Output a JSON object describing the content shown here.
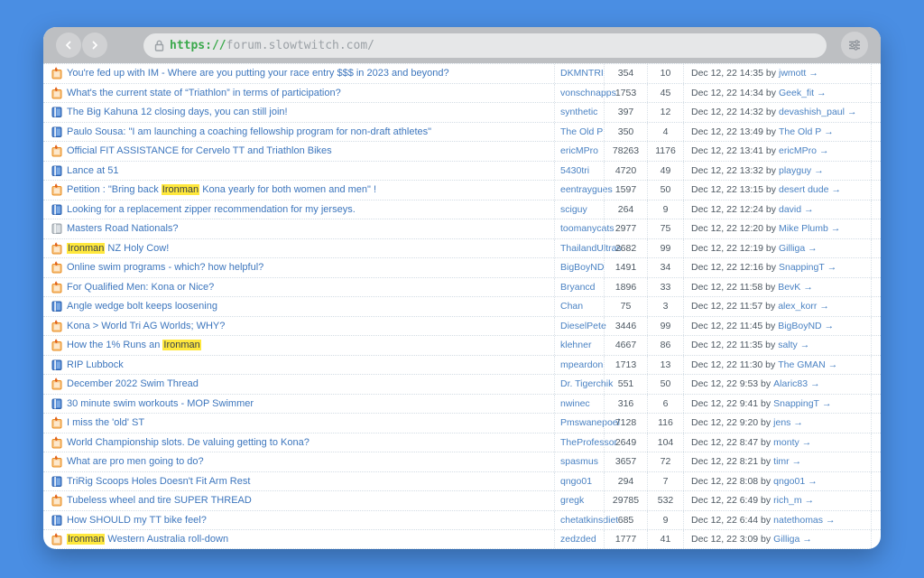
{
  "browser": {
    "url_scheme": "https://",
    "url_host": "forum.slowtwitch.com/",
    "icons": {
      "back": "chevron-left",
      "forward": "chevron-right",
      "lock": "padlock",
      "menu": "menu-sliders"
    }
  },
  "forum": {
    "icon_colors": {
      "hot_border": "#ea8c1e",
      "hot_fill": "#f7c98e",
      "hot_flame": "#e2621b",
      "normal_border": "#2d62ae",
      "normal_fill": "#4f86d2",
      "inactive_border": "#9aa2a9",
      "inactive_fill": "#c6ccd1"
    },
    "highlight_color": "#ffe83d",
    "rows": [
      {
        "icon": "hot",
        "title_parts": [
          {
            "t": "You're fed up with IM - Where are you putting your race entry $$$ in 2023 and beyond?",
            "hl": false
          }
        ],
        "author": "DKMNTRI",
        "views": "354",
        "replies": "10",
        "date": "Dec 12, 22 14:35",
        "by": "by",
        "last": "jwmott",
        "arrow": "→"
      },
      {
        "icon": "hot",
        "title_parts": [
          {
            "t": "What's the current state of “Triathlon” in terms of participation?",
            "hl": false
          }
        ],
        "author": "vonschnapps",
        "views": "1753",
        "replies": "45",
        "date": "Dec 12, 22 14:34",
        "by": "by",
        "last": "Geek_fit",
        "arrow": "→"
      },
      {
        "icon": "normal",
        "title_parts": [
          {
            "t": "The Big Kahuna 12 closing days, you can still join!",
            "hl": false
          }
        ],
        "author": "synthetic",
        "views": "397",
        "replies": "12",
        "date": "Dec 12, 22 14:32",
        "by": "by",
        "last": "devashish_paul",
        "arrow": "→"
      },
      {
        "icon": "normal",
        "title_parts": [
          {
            "t": "Paulo Sousa: \"I am launching a coaching fellowship program for non-draft athletes\"",
            "hl": false
          }
        ],
        "author": "The Old P",
        "views": "350",
        "replies": "4",
        "date": "Dec 12, 22 13:49",
        "by": "by",
        "last": "The Old P",
        "arrow": "→"
      },
      {
        "icon": "hot",
        "title_parts": [
          {
            "t": "Official FIT ASSISTANCE for Cervelo TT and Triathlon Bikes",
            "hl": false
          }
        ],
        "author": "ericMPro",
        "views": "78263",
        "replies": "1176",
        "date": "Dec 12, 22 13:41",
        "by": "by",
        "last": "ericMPro",
        "arrow": "→"
      },
      {
        "icon": "normal",
        "title_parts": [
          {
            "t": "Lance at 51",
            "hl": false
          }
        ],
        "author": "5430tri",
        "views": "4720",
        "replies": "49",
        "date": "Dec 12, 22 13:32",
        "by": "by",
        "last": "playguy",
        "arrow": "→"
      },
      {
        "icon": "hot",
        "title_parts": [
          {
            "t": "Petition : \"Bring back ",
            "hl": false
          },
          {
            "t": "Ironman",
            "hl": true
          },
          {
            "t": " Kona yearly for both women and men\" !",
            "hl": false
          }
        ],
        "author": "eentraygues",
        "views": "1597",
        "replies": "50",
        "date": "Dec 12, 22 13:15",
        "by": "by",
        "last": "desert dude",
        "arrow": "→"
      },
      {
        "icon": "normal",
        "title_parts": [
          {
            "t": "Looking for a replacement zipper recommendation for my jerseys.",
            "hl": false
          }
        ],
        "author": "sciguy",
        "views": "264",
        "replies": "9",
        "date": "Dec 12, 22 12:24",
        "by": "by",
        "last": "david",
        "arrow": "→"
      },
      {
        "icon": "inactive",
        "title_parts": [
          {
            "t": "Masters Road Nationals?",
            "hl": false
          }
        ],
        "author": "toomanycats",
        "views": "2977",
        "replies": "75",
        "date": "Dec 12, 22 12:20",
        "by": "by",
        "last": "Mike Plumb",
        "arrow": "→"
      },
      {
        "icon": "hot",
        "title_parts": [
          {
            "t": "Ironman",
            "hl": true
          },
          {
            "t": " NZ Holy Cow!",
            "hl": false
          }
        ],
        "author": "ThailandUltras",
        "views": "2682",
        "replies": "99",
        "date": "Dec 12, 22 12:19",
        "by": "by",
        "last": "Gilliga",
        "arrow": "→"
      },
      {
        "icon": "hot",
        "title_parts": [
          {
            "t": "Online swim programs - which? how helpful?",
            "hl": false
          }
        ],
        "author": "BigBoyND",
        "views": "1491",
        "replies": "34",
        "date": "Dec 12, 22 12:16",
        "by": "by",
        "last": "SnappingT",
        "arrow": "→"
      },
      {
        "icon": "hot",
        "title_parts": [
          {
            "t": "For Qualified Men: Kona or Nice?",
            "hl": false
          }
        ],
        "author": "Bryancd",
        "views": "1896",
        "replies": "33",
        "date": "Dec 12, 22 11:58",
        "by": "by",
        "last": "BevK",
        "arrow": "→"
      },
      {
        "icon": "normal",
        "title_parts": [
          {
            "t": "Angle wedge bolt keeps loosening",
            "hl": false
          }
        ],
        "author": "Chan",
        "views": "75",
        "replies": "3",
        "date": "Dec 12, 22 11:57",
        "by": "by",
        "last": "alex_korr",
        "arrow": "→"
      },
      {
        "icon": "hot",
        "title_parts": [
          {
            "t": "Kona > World Tri AG Worlds; WHY?",
            "hl": false
          }
        ],
        "author": "DieselPete",
        "views": "3446",
        "replies": "99",
        "date": "Dec 12, 22 11:45",
        "by": "by",
        "last": "BigBoyND",
        "arrow": "→"
      },
      {
        "icon": "hot",
        "title_parts": [
          {
            "t": "How the 1% Runs an ",
            "hl": false
          },
          {
            "t": "Ironman",
            "hl": true
          }
        ],
        "author": "klehner",
        "views": "4667",
        "replies": "86",
        "date": "Dec 12, 22 11:35",
        "by": "by",
        "last": "salty",
        "arrow": "→"
      },
      {
        "icon": "normal",
        "title_parts": [
          {
            "t": "RIP Lubbock",
            "hl": false
          }
        ],
        "author": "mpeardon",
        "views": "1713",
        "replies": "13",
        "date": "Dec 12, 22 11:30",
        "by": "by",
        "last": "The GMAN",
        "arrow": "→"
      },
      {
        "icon": "hot",
        "title_parts": [
          {
            "t": "December 2022 Swim Thread",
            "hl": false
          }
        ],
        "author": "Dr. Tigerchik",
        "views": "551",
        "replies": "50",
        "date": "Dec 12, 22 9:53",
        "by": "by",
        "last": "Alaric83",
        "arrow": "→"
      },
      {
        "icon": "normal",
        "title_parts": [
          {
            "t": "30 minute swim workouts - MOP Swimmer",
            "hl": false
          }
        ],
        "author": "nwinec",
        "views": "316",
        "replies": "6",
        "date": "Dec 12, 22 9:41",
        "by": "by",
        "last": "SnappingT",
        "arrow": "→"
      },
      {
        "icon": "hot",
        "title_parts": [
          {
            "t": "I miss the 'old' ST",
            "hl": false
          }
        ],
        "author": "Pmswanepoel",
        "views": "7128",
        "replies": "116",
        "date": "Dec 12, 22 9:20",
        "by": "by",
        "last": "jens",
        "arrow": "→"
      },
      {
        "icon": "hot",
        "title_parts": [
          {
            "t": "World Championship slots. De valuing getting to Kona?",
            "hl": false
          }
        ],
        "author": "TheProfessor",
        "views": "2649",
        "replies": "104",
        "date": "Dec 12, 22 8:47",
        "by": "by",
        "last": "monty",
        "arrow": "→"
      },
      {
        "icon": "hot",
        "title_parts": [
          {
            "t": "What are pro men going to do?",
            "hl": false
          }
        ],
        "author": "spasmus",
        "views": "3657",
        "replies": "72",
        "date": "Dec 12, 22 8:21",
        "by": "by",
        "last": "timr",
        "arrow": "→"
      },
      {
        "icon": "normal",
        "title_parts": [
          {
            "t": "TriRig Scoops Holes Doesn't Fit Arm Rest",
            "hl": false
          }
        ],
        "author": "qngo01",
        "views": "294",
        "replies": "7",
        "date": "Dec 12, 22 8:08",
        "by": "by",
        "last": "qngo01",
        "arrow": "→"
      },
      {
        "icon": "hot",
        "title_parts": [
          {
            "t": "Tubeless wheel and tire SUPER THREAD",
            "hl": false
          }
        ],
        "author": "gregk",
        "views": "29785",
        "replies": "532",
        "date": "Dec 12, 22 6:49",
        "by": "by",
        "last": "rich_m",
        "arrow": "→"
      },
      {
        "icon": "normal",
        "title_parts": [
          {
            "t": "How SHOULD my TT bike feel?",
            "hl": false
          }
        ],
        "author": "chetatkinsdiet",
        "views": "685",
        "replies": "9",
        "date": "Dec 12, 22 6:44",
        "by": "by",
        "last": "natethomas",
        "arrow": "→"
      },
      {
        "icon": "hot",
        "title_parts": [
          {
            "t": "Ironman",
            "hl": true
          },
          {
            "t": " Western Australia roll-down",
            "hl": false
          }
        ],
        "author": "zedzded",
        "views": "1777",
        "replies": "41",
        "date": "Dec 12, 22 3:09",
        "by": "by",
        "last": "Gilliga",
        "arrow": "→"
      }
    ]
  }
}
